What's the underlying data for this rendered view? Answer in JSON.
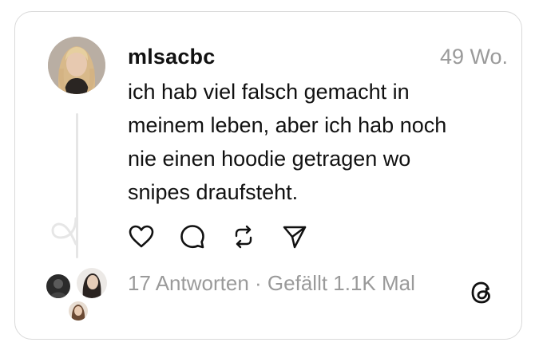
{
  "post": {
    "username": "mlsacbc",
    "timestamp": "49 Wo.",
    "text_lines": [
      "ich hab viel falsch gemacht in",
      "meinem leben, aber ich hab noch",
      "nie einen hoodie getragen wo",
      "snipes draufsteht."
    ]
  },
  "footer": {
    "replies": "17 Antworten",
    "separator": "·",
    "likes": "Gefällt 1.1K Mal"
  },
  "icons": {
    "like": "heart-icon",
    "reply": "comment-icon",
    "repost": "repost-icon",
    "share": "send-icon",
    "brand": "threads-logo-icon"
  },
  "colors": {
    "text": "#111111",
    "muted": "#9a9a9a",
    "border": "#d9d9d9"
  }
}
